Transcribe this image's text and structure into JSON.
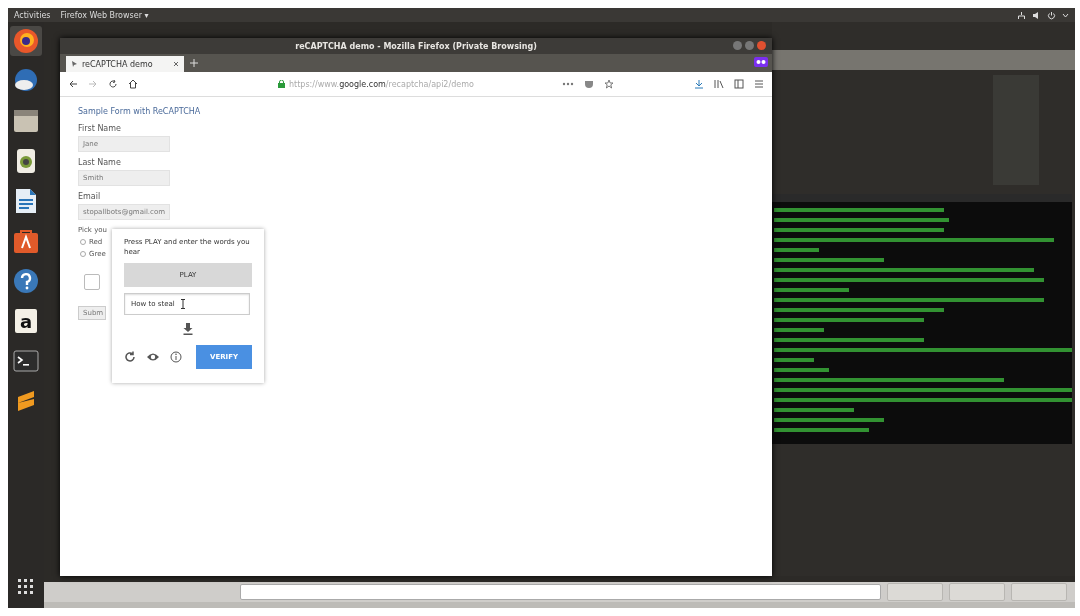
{
  "top_bar": {
    "activities": "Activities",
    "app_menu": "Firefox Web Browser ▾"
  },
  "dock": {
    "items": [
      {
        "kind": "browser",
        "selected": true
      },
      {
        "kind": "mail",
        "selected": false
      },
      {
        "kind": "files",
        "selected": false
      },
      {
        "kind": "music",
        "selected": false
      },
      {
        "kind": "writer",
        "selected": false
      },
      {
        "kind": "store",
        "selected": false
      },
      {
        "kind": "help",
        "selected": false
      },
      {
        "kind": "amazon",
        "glyph": "a",
        "selected": false
      },
      {
        "kind": "terminal",
        "selected": false
      },
      {
        "kind": "editor",
        "selected": false
      }
    ]
  },
  "browser": {
    "title": "reCAPTCHA demo - Mozilla Firefox (Private Browsing)",
    "tab": "reCAPTCHA demo",
    "url_prefix": "https://www.",
    "url_host": "google.com",
    "url_path": "/recaptcha/api2/demo",
    "page": {
      "heading": "Sample Form with ReCAPTCHA",
      "fields": [
        {
          "label": "First Name",
          "value": "Jane"
        },
        {
          "label": "Last Name",
          "value": "Smith"
        },
        {
          "label": "Email",
          "value": "stopallbots@gmail.com"
        }
      ],
      "question": "Pick you",
      "radios": [
        {
          "label": "Red",
          "selected": false
        },
        {
          "label": "Gree",
          "selected": false
        }
      ],
      "checkbox": {
        "checked": false
      },
      "submit": "Subm"
    },
    "captcha": {
      "instruction": "Press PLAY and enter the words you hear",
      "play": "PLAY",
      "answer": "How to steal",
      "verify": "VERIFY"
    }
  }
}
